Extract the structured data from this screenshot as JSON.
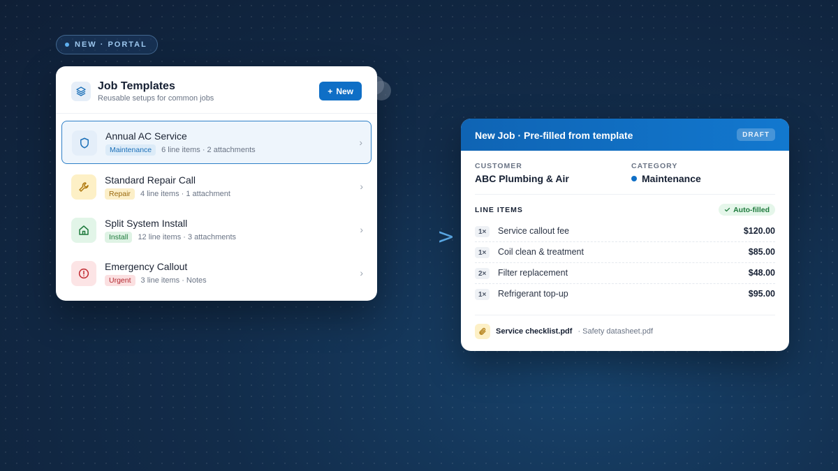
{
  "pill": {
    "label": "NEW · PORTAL"
  },
  "templates_card": {
    "title": "Job Templates",
    "subtitle": "Reusable setups for common jobs",
    "new_button": "New",
    "items": [
      {
        "name": "Annual AC Service",
        "tag": "Maintenance",
        "meta": "6 line items · 2 attachments",
        "icon": "shield-icon",
        "tag_color": "#1a6fb8",
        "tag_bg": "#dcebf8",
        "icon_bg": "#e4eef9",
        "icon_color": "#1a6fb8"
      },
      {
        "name": "Standard Repair Call",
        "tag": "Repair",
        "meta": "4 line items · 1 attachment",
        "icon": "wrench-icon",
        "tag_color": "#9a6a10",
        "tag_bg": "#fcefc8",
        "icon_bg": "#fdf0c6",
        "icon_color": "#b07a10"
      },
      {
        "name": "Split System Install",
        "tag": "Install",
        "meta": "12 line items · 3 attachments",
        "icon": "home-icon",
        "tag_color": "#1e7a3c",
        "tag_bg": "#dff3e5",
        "icon_bg": "#e2f5e8",
        "icon_color": "#1e7a3c"
      },
      {
        "name": "Emergency Callout",
        "tag": "Urgent",
        "meta": "3 line items · Notes",
        "icon": "alert-icon",
        "tag_color": "#b3262e",
        "tag_bg": "#fbe0e1",
        "icon_bg": "#fce4e5",
        "icon_color": "#c0282f"
      }
    ]
  },
  "job_card": {
    "title": "New Job · Pre-filled from template",
    "badge": "DRAFT",
    "customer_label": "CUSTOMER",
    "customer": "ABC Plumbing & Air",
    "category_label": "CATEGORY",
    "category": "Maintenance",
    "line_items_label": "LINE ITEMS",
    "auto_badge": "Auto-filled",
    "lines": [
      {
        "qty": "1×",
        "desc": "Service callout fee",
        "price": "$120.00"
      },
      {
        "qty": "1×",
        "desc": "Coil clean & treatment",
        "price": "$85.00"
      },
      {
        "qty": "2×",
        "desc": "Filter replacement",
        "price": "$48.00"
      },
      {
        "qty": "1×",
        "desc": "Refrigerant top-up",
        "price": "$95.00"
      }
    ],
    "attachment_main": "Service checklist.pdf",
    "attachment_rest": "· Safety datasheet.pdf"
  },
  "colors": {
    "accent": "#0f6fc6",
    "background": "#122c4a"
  }
}
